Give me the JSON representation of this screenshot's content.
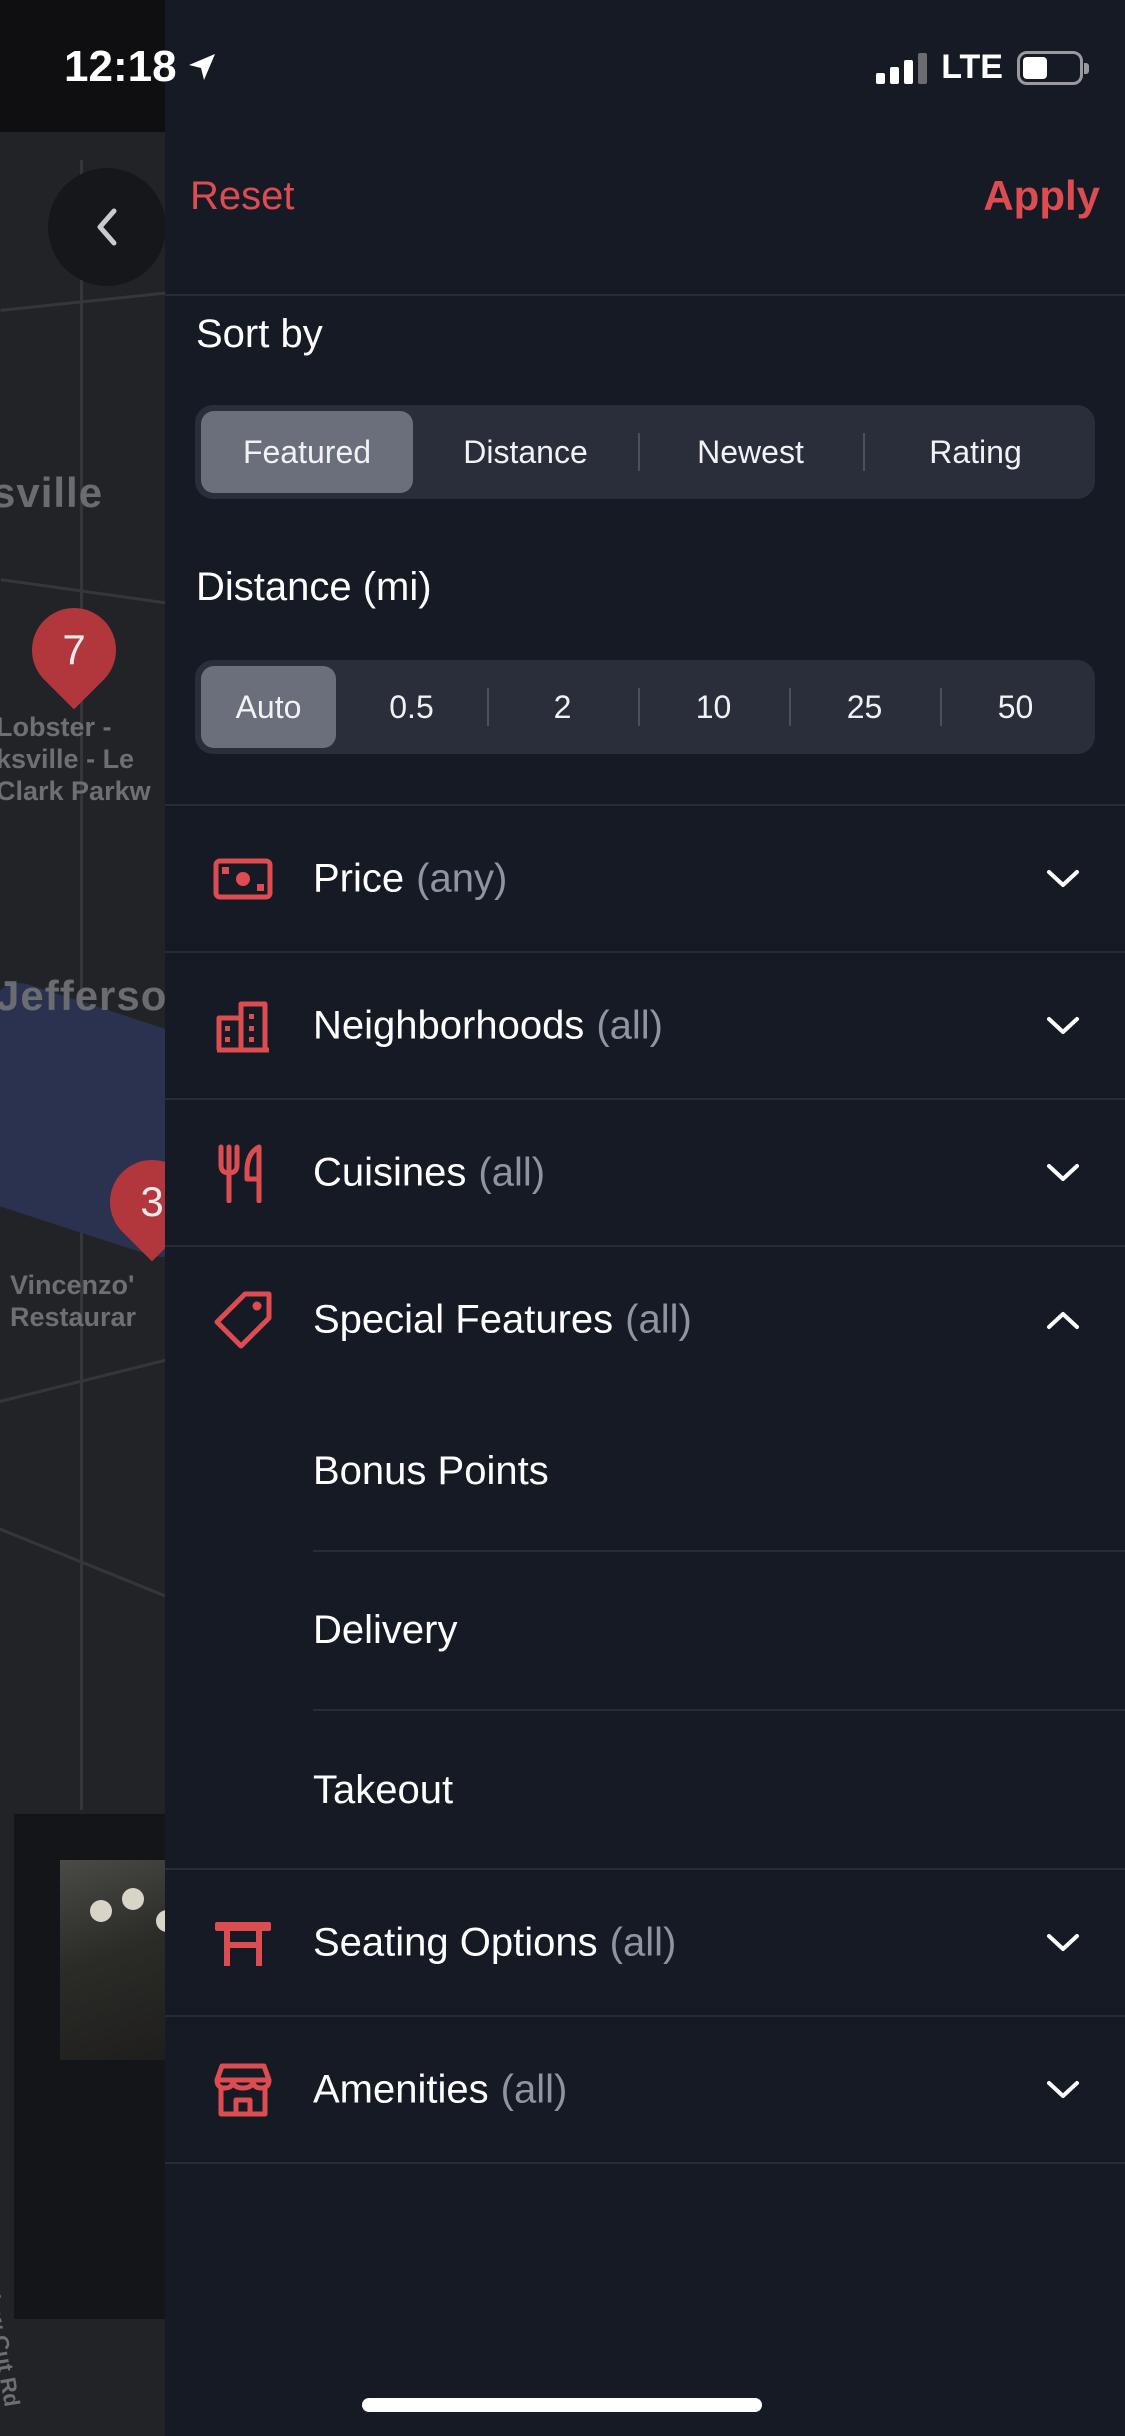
{
  "status_bar": {
    "time": "12:18",
    "network": "LTE"
  },
  "map": {
    "labels": [
      {
        "text": "sville",
        "big": true
      },
      {
        "text": "Lobster -"
      },
      {
        "text": "ksville - Le"
      },
      {
        "text": "Clark Parkw"
      },
      {
        "text": "Jefferso",
        "big": true
      },
      {
        "text": "Vincenzo'"
      },
      {
        "text": "Restaurar"
      },
      {
        "text": "New Cut Rd"
      }
    ],
    "pins": [
      "7",
      "3"
    ]
  },
  "header": {
    "reset_label": "Reset",
    "apply_label": "Apply"
  },
  "sort": {
    "title": "Sort by",
    "options": [
      "Featured",
      "Distance",
      "Newest",
      "Rating"
    ],
    "selected": "Featured"
  },
  "distance": {
    "title": "Distance (mi)",
    "options": [
      "Auto",
      "0.5",
      "2",
      "10",
      "25",
      "50"
    ],
    "selected": "Auto"
  },
  "filters": [
    {
      "label": "Price",
      "value": "(any)",
      "icon": "cash-icon",
      "expanded": false
    },
    {
      "label": "Neighborhoods",
      "value": "(all)",
      "icon": "buildings-icon",
      "expanded": false
    },
    {
      "label": "Cuisines",
      "value": "(all)",
      "icon": "utensils-icon",
      "expanded": false
    },
    {
      "label": "Special Features",
      "value": "(all)",
      "icon": "tag-icon",
      "expanded": true,
      "options": [
        "Bonus Points",
        "Delivery",
        "Takeout"
      ]
    },
    {
      "label": "Seating Options",
      "value": "(all)",
      "icon": "table-icon",
      "expanded": false
    },
    {
      "label": "Amenities",
      "value": "(all)",
      "icon": "store-icon",
      "expanded": false
    }
  ],
  "colors": {
    "accent": "#dc4c50",
    "panel": "#161a25",
    "segment": "#2a2e3a",
    "segment_active": "#6b6f7b"
  }
}
